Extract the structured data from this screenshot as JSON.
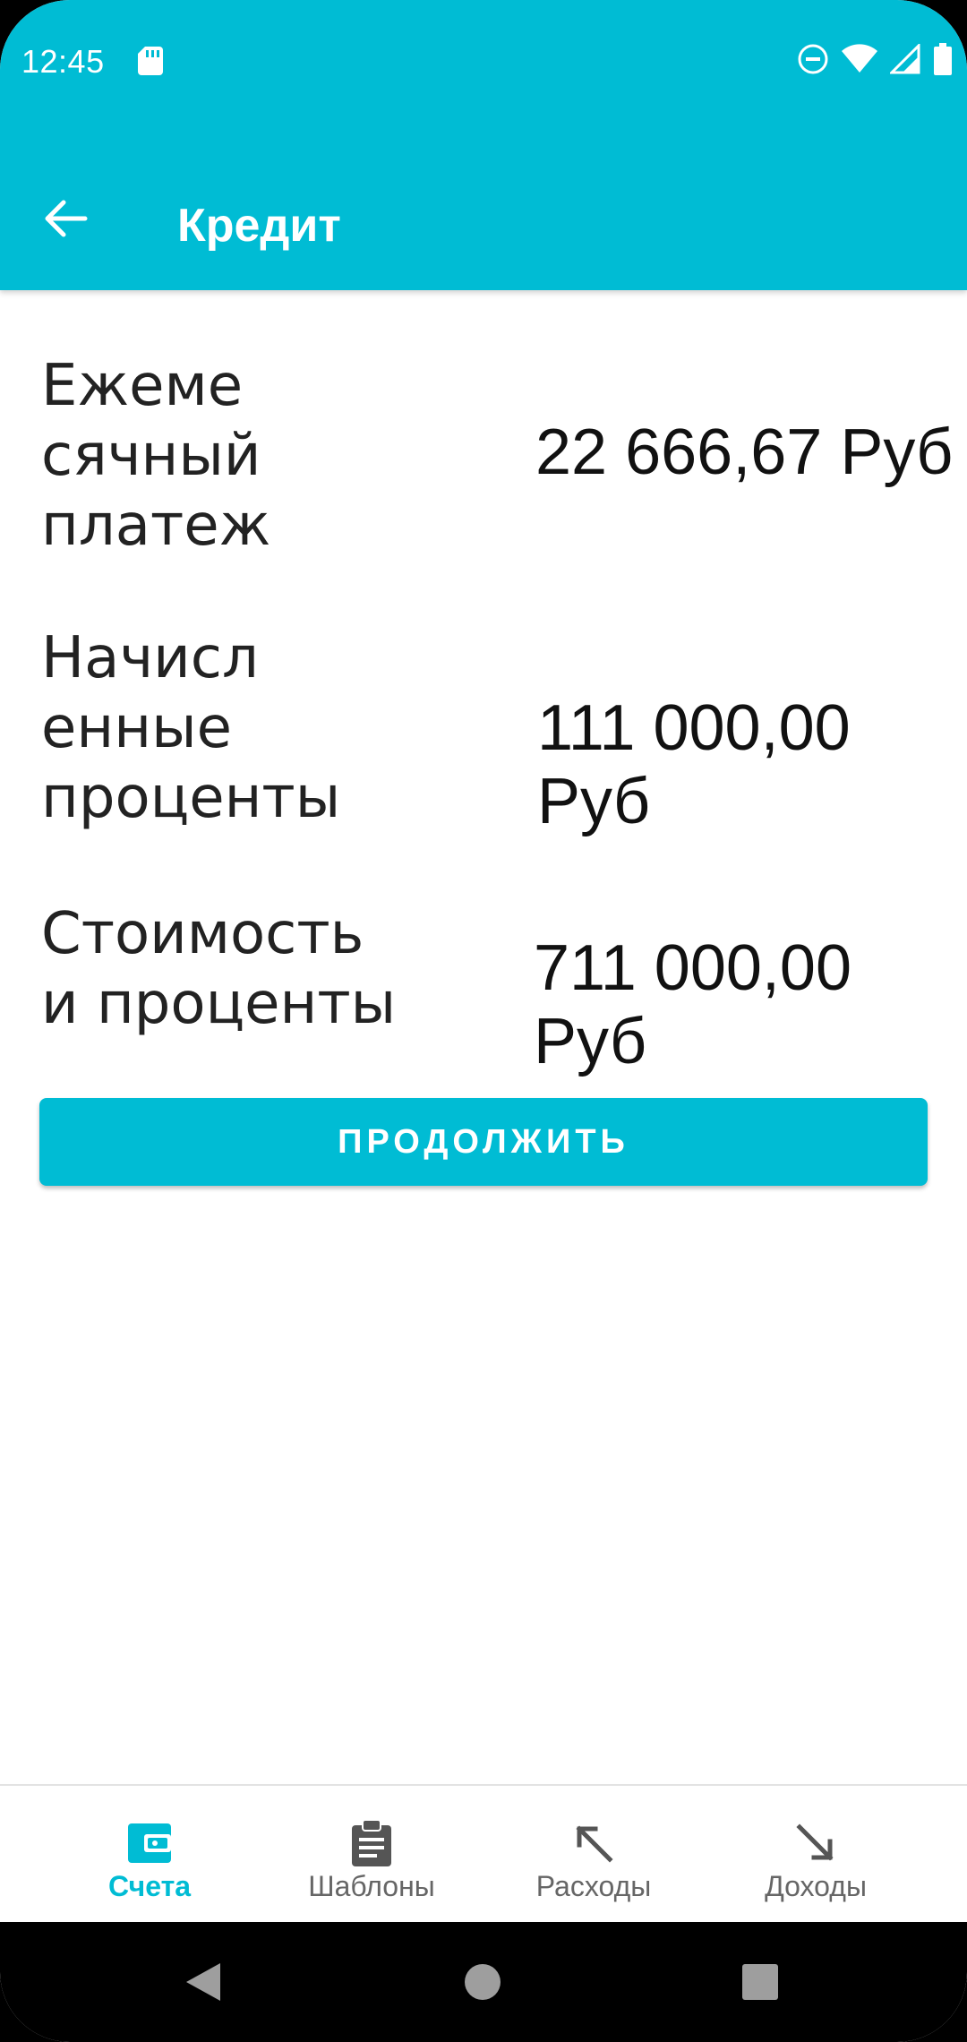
{
  "status_bar": {
    "time": "12:45",
    "icons": [
      "sd-card-icon",
      "dnd-icon",
      "wifi-icon",
      "signal-icon",
      "battery-icon"
    ]
  },
  "app_bar": {
    "back_icon": "arrow-back-icon",
    "title": "Кредит",
    "color": "#00BCD4"
  },
  "results": [
    {
      "label": "Ежеме\nсячный\nплатеж",
      "value": "22 666,67 Руб"
    },
    {
      "label": "Начисл\nенные\nпроценты",
      "value": "111 000,00 Руб"
    },
    {
      "label": "Стоимость\nи проценты",
      "value": "711 000,00 Руб"
    }
  ],
  "continue_button": {
    "label": "ПРОДОЛЖИТЬ"
  },
  "bottom_nav": {
    "items": [
      {
        "label": "Счета",
        "icon": "wallet-icon",
        "active": true
      },
      {
        "label": "Шаблоны",
        "icon": "clipboard-icon",
        "active": false
      },
      {
        "label": "Расходы",
        "icon": "arrow-up-left-icon",
        "active": false
      },
      {
        "label": "Доходы",
        "icon": "arrow-down-right-icon",
        "active": false
      }
    ]
  },
  "system_nav": {
    "icons": [
      "back-triangle-icon",
      "home-circle-icon",
      "recents-square-icon"
    ]
  }
}
